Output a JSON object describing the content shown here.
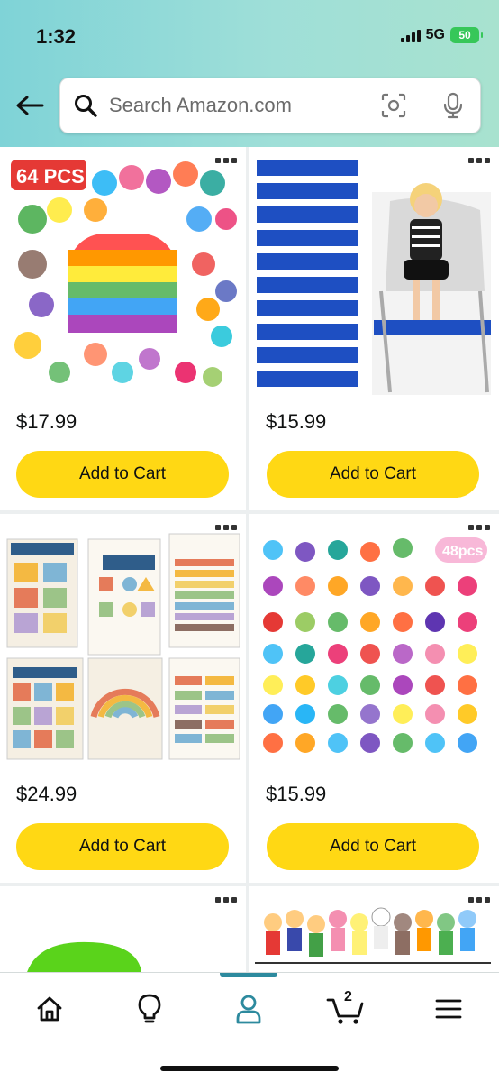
{
  "status": {
    "time": "1:32",
    "network": "5G",
    "battery": "50"
  },
  "search": {
    "placeholder": "Search Amazon.com"
  },
  "products": [
    {
      "price": "$17.99",
      "button": "Add to Cart",
      "badge": "64 PCS"
    },
    {
      "price": "$15.99",
      "button": "Add to Cart"
    },
    {
      "price": "$24.99",
      "button": "Add to Cart"
    },
    {
      "price": "$15.99",
      "button": "Add to Cart",
      "badge": "48pcs"
    }
  ],
  "nav": {
    "cart_count": "2"
  },
  "colors": {
    "accent": "#ffd814",
    "active_tab": "#2d8a9e"
  }
}
